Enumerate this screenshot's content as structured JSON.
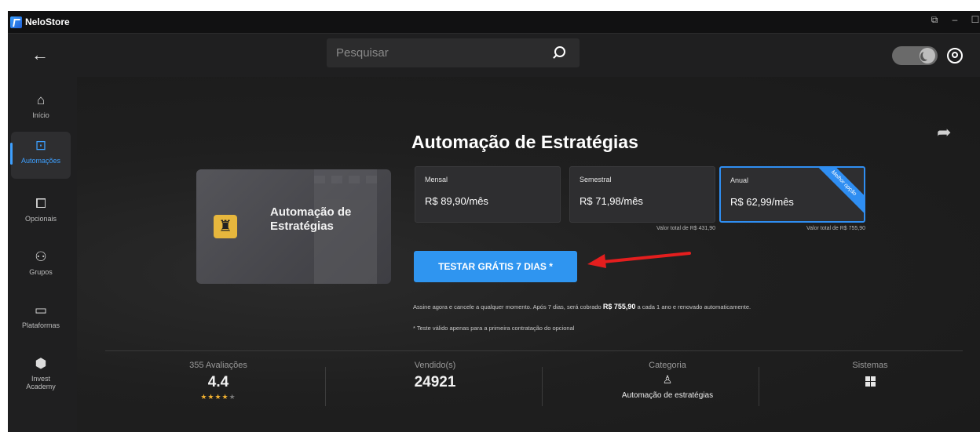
{
  "window": {
    "title": "NeloStore"
  },
  "search": {
    "placeholder": "Pesquisar"
  },
  "sidebar": {
    "items": [
      {
        "label": "Início",
        "icon": "home-icon"
      },
      {
        "label": "Automações",
        "icon": "automation-icon",
        "active": true
      },
      {
        "label": "Opcionais",
        "icon": "puzzle-icon"
      },
      {
        "label": "Grupos",
        "icon": "users-icon"
      },
      {
        "label": "Plataformas",
        "icon": "platform-icon"
      },
      {
        "label": "Invest Academy",
        "icon": "academy-icon"
      }
    ]
  },
  "product": {
    "card_title": "Automação de Estratégias",
    "title": "Automação de Estratégias"
  },
  "plans": [
    {
      "name": "Mensal",
      "price": "R$ 89,90/mês",
      "total": ""
    },
    {
      "name": "Semestral",
      "price": "R$ 71,98/mês",
      "total": "Valor total de R$ 431,90"
    },
    {
      "name": "Anual",
      "price": "R$ 62,99/mês",
      "total": "Valor total de R$ 755,90",
      "ribbon": "Melhor opção",
      "selected": true
    }
  ],
  "cta": {
    "label": "TESTAR GRÁTIS 7 DIAS *"
  },
  "disclaimer": {
    "before": "Assine agora e cancele a qualquer momento. Após 7 dias, será cobrado ",
    "amount": "R$ 755,90",
    "after": " a cada 1 ano e renovado automaticamente."
  },
  "note": "* Teste válido apenas para a primeira contratação do opcional",
  "stats": {
    "reviews_label": "355 Avaliações",
    "rating": "4.4",
    "rating_value": 4.4,
    "sold_label": "Vendido(s)",
    "sold": "24921",
    "category_label": "Categoria",
    "category": "Automação de estratégias",
    "systems_label": "Sistemas"
  },
  "colors": {
    "accent": "#2f95f0",
    "arrow": "#e41e1e",
    "star": "#f0b030"
  }
}
